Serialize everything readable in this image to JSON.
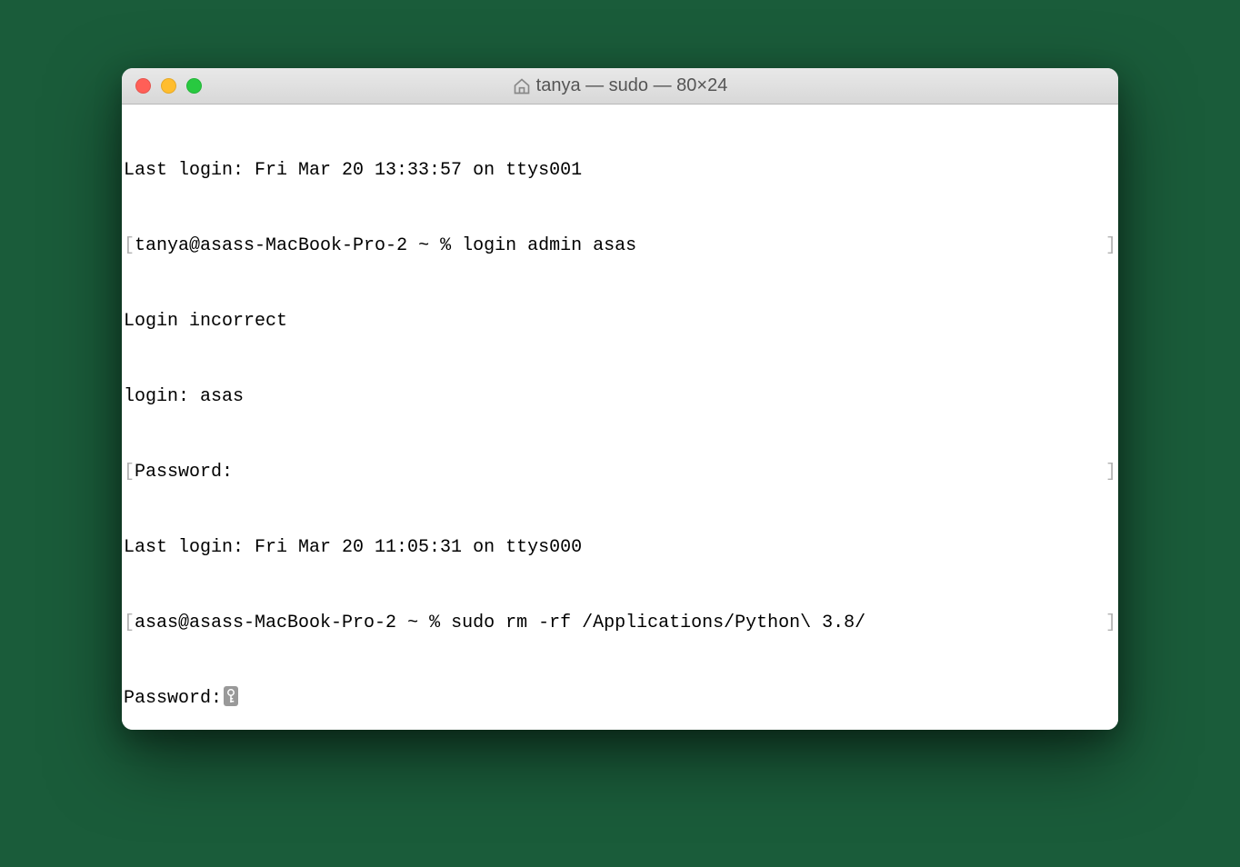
{
  "window": {
    "title": "tanya — sudo — 80×24"
  },
  "terminal": {
    "lines": [
      {
        "text": "Last login: Fri Mar 20 13:33:57 on ttys001",
        "bracketed": false
      },
      {
        "text": "tanya@asass-MacBook-Pro-2 ~ % login admin asas",
        "bracketed": true
      },
      {
        "text": "Login incorrect",
        "bracketed": false
      },
      {
        "text": "login: asas",
        "bracketed": false
      },
      {
        "text": "Password:",
        "bracketed": true
      },
      {
        "text": "Last login: Fri Mar 20 11:05:31 on ttys000",
        "bracketed": false
      },
      {
        "text": "asas@asass-MacBook-Pro-2 ~ % sudo rm -rf /Applications/Python\\ 3.8/",
        "bracketed": true
      }
    ],
    "password_prompt": "Password:"
  }
}
